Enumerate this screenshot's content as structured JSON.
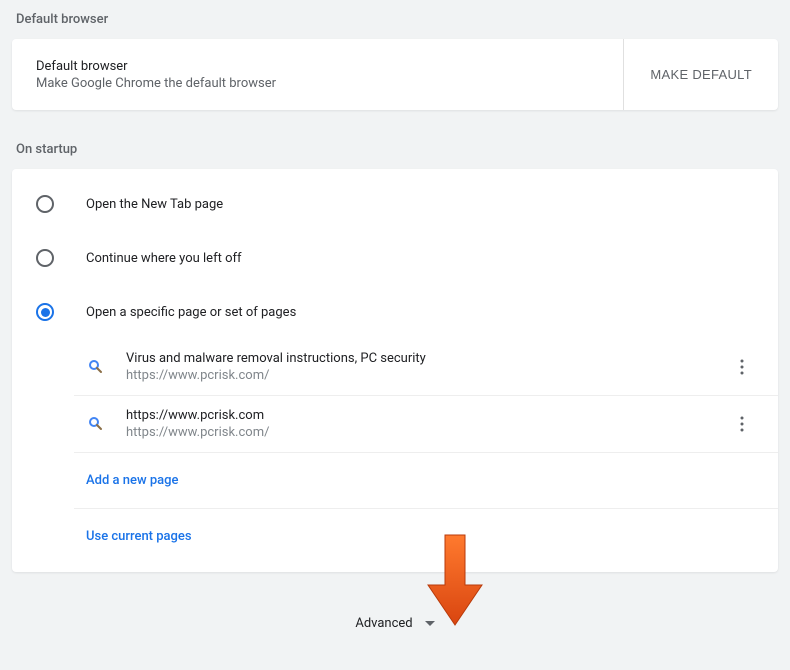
{
  "defaultBrowser": {
    "header": "Default browser",
    "title": "Default browser",
    "subtitle": "Make Google Chrome the default browser",
    "buttonLabel": "MAKE DEFAULT"
  },
  "onStartup": {
    "header": "On startup",
    "options": [
      {
        "label": "Open the New Tab page",
        "selected": false
      },
      {
        "label": "Continue where you left off",
        "selected": false
      },
      {
        "label": "Open a specific page or set of pages",
        "selected": true
      }
    ],
    "pages": [
      {
        "title": "Virus and malware removal instructions, PC security",
        "url": "https://www.pcrisk.com/"
      },
      {
        "title": "https://www.pcrisk.com",
        "url": "https://www.pcrisk.com/"
      }
    ],
    "addPageLabel": "Add a new page",
    "useCurrentLabel": "Use current pages"
  },
  "advanced": {
    "label": "Advanced"
  }
}
